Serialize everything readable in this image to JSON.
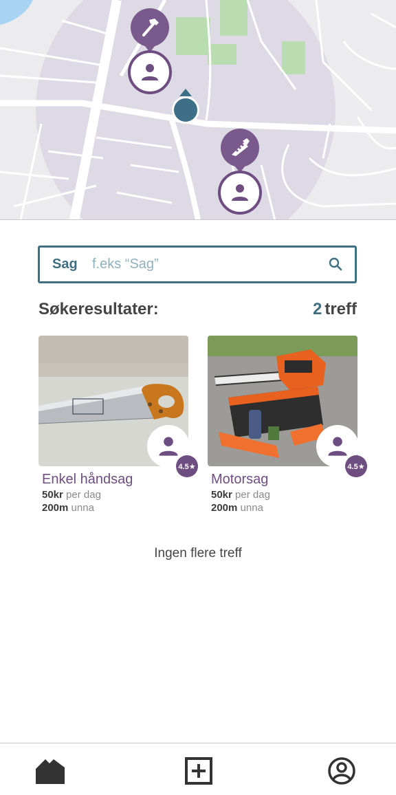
{
  "search": {
    "label": "Sag",
    "placeholder": "f.eks “Sag”"
  },
  "results": {
    "title": "Søkeresultater:",
    "count": "2",
    "count_suffix": "treff"
  },
  "listings": [
    {
      "title": "Enkel håndsag",
      "price": "50kr",
      "price_suffix": "per dag",
      "distance": "200m",
      "distance_suffix": "unna",
      "rating": "4.5★"
    },
    {
      "title": "Motorsag",
      "price": "50kr",
      "price_suffix": "per dag",
      "distance": "200m",
      "distance_suffix": "unna",
      "rating": "4.5★"
    }
  ],
  "footer_note": "Ingen flere treff",
  "map": {
    "pins": [
      "hammer-icon",
      "saw-icon"
    ]
  },
  "colors": {
    "accent_purple": "#6e4d80",
    "accent_teal": "#3f6f80",
    "map_bg": "#ececee"
  },
  "nav": [
    "home-icon",
    "add-icon",
    "profile-icon"
  ]
}
